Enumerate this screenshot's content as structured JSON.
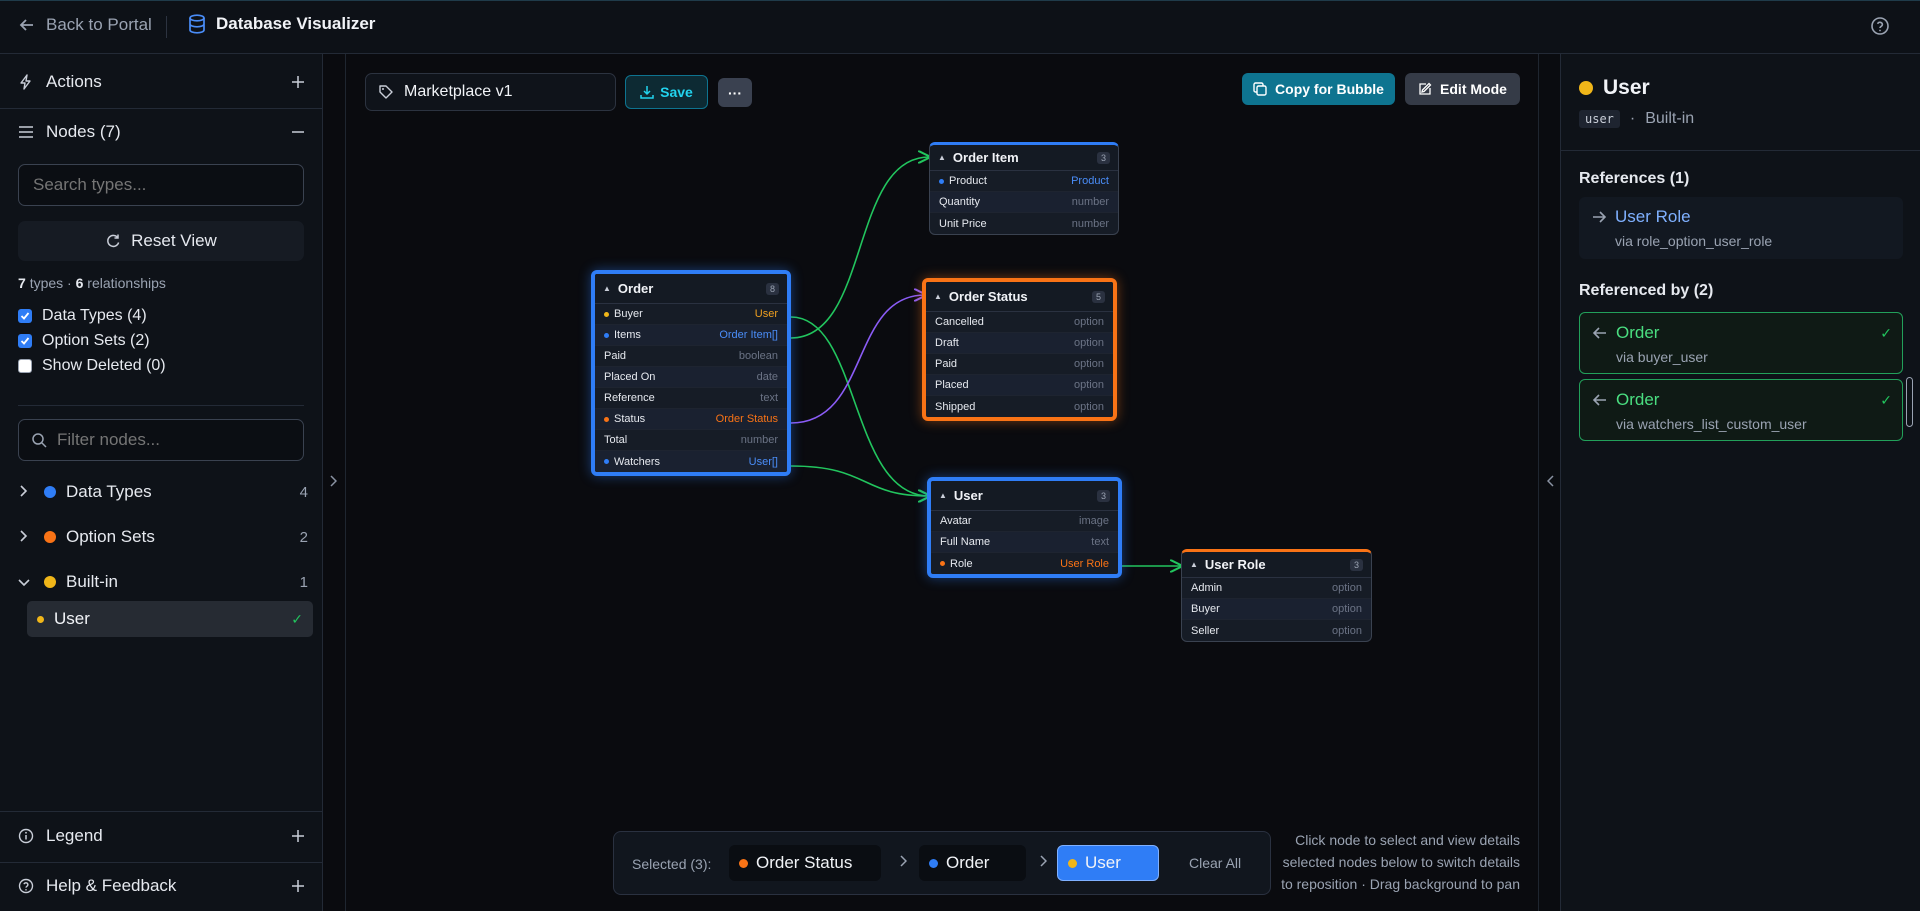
{
  "topbar": {
    "back_label": "Back to Portal",
    "app_title": "Database Visualizer"
  },
  "sidebar": {
    "actions_label": "Actions",
    "nodes_label": "Nodes (7)",
    "search_placeholder": "Search types...",
    "reset_label": "Reset View",
    "stats": {
      "types_count": "7",
      "types_word": "types",
      "sep": "·",
      "rel_count": "6",
      "rel_word": "relationships"
    },
    "filters": [
      {
        "label": "Data Types (4)",
        "checked": true
      },
      {
        "label": "Option Sets (2)",
        "checked": true
      },
      {
        "label": "Show Deleted (0)",
        "checked": false
      }
    ],
    "filter_placeholder": "Filter nodes...",
    "tree": [
      {
        "label": "Data Types",
        "count": "4",
        "color": "#2f7df6",
        "expanded": false
      },
      {
        "label": "Option Sets",
        "count": "2",
        "color": "#f97316",
        "expanded": false
      },
      {
        "label": "Built-in",
        "count": "1",
        "color": "#f0b619",
        "expanded": true
      }
    ],
    "tree_leaf": {
      "label": "User",
      "check": "✓"
    },
    "legend_label": "Legend",
    "help_label": "Help & Feedback"
  },
  "toolbar": {
    "schema_name": "Marketplace v1",
    "save_label": "Save",
    "more_label": "···",
    "copy_label": "Copy for Bubble",
    "edit_label": "Edit Mode"
  },
  "nodes": {
    "order": {
      "title": "Order",
      "count": "8",
      "fields": [
        {
          "name": "Buyer",
          "type": "User"
        },
        {
          "name": "Items",
          "type": "Order Item[]"
        },
        {
          "name": "Paid",
          "type": "boolean"
        },
        {
          "name": "Placed On",
          "type": "date"
        },
        {
          "name": "Reference",
          "type": "text"
        },
        {
          "name": "Status",
          "type": "Order Status"
        },
        {
          "name": "Total",
          "type": "number"
        },
        {
          "name": "Watchers",
          "type": "User[]"
        }
      ]
    },
    "order_item": {
      "title": "Order Item",
      "count": "3",
      "fields": [
        {
          "name": "Product",
          "type": "Product"
        },
        {
          "name": "Quantity",
          "type": "number"
        },
        {
          "name": "Unit Price",
          "type": "number"
        }
      ]
    },
    "order_status": {
      "title": "Order Status",
      "count": "5",
      "fields": [
        {
          "name": "Cancelled",
          "type": "option"
        },
        {
          "name": "Draft",
          "type": "option"
        },
        {
          "name": "Paid",
          "type": "option"
        },
        {
          "name": "Placed",
          "type": "option"
        },
        {
          "name": "Shipped",
          "type": "option"
        }
      ]
    },
    "user": {
      "title": "User",
      "count": "3",
      "fields": [
        {
          "name": "Avatar",
          "type": "image"
        },
        {
          "name": "Full Name",
          "type": "text"
        },
        {
          "name": "Role",
          "type": "User Role"
        }
      ]
    },
    "user_role": {
      "title": "User Role",
      "count": "3",
      "fields": [
        {
          "name": "Admin",
          "type": "option"
        },
        {
          "name": "Buyer",
          "type": "option"
        },
        {
          "name": "Seller",
          "type": "option"
        }
      ]
    }
  },
  "selection": {
    "label": "Selected (3):",
    "chips": [
      {
        "label": "Order Status",
        "color": "#f97316"
      },
      {
        "label": "Order",
        "color": "#2f7df6"
      },
      {
        "label": "User",
        "color": "#f0b619"
      }
    ],
    "clear_label": "Clear All",
    "hint_lines": [
      "Click node to select and view details",
      "selected nodes below to switch details",
      "to reposition · Drag background to pan"
    ]
  },
  "details": {
    "title": "User",
    "code": "user",
    "sep": "·",
    "kind": "Built-in",
    "references_heading": "References (1)",
    "references": [
      {
        "name": "User Role",
        "via": "via role_option_user_role"
      }
    ],
    "referenced_by_heading": "Referenced by (2)",
    "referenced_by": [
      {
        "name": "Order",
        "via": "via buyer_user",
        "check": "✓"
      },
      {
        "name": "Order",
        "via": "via watchers_list_custom_user",
        "check": "✓"
      }
    ]
  },
  "colors": {
    "data_type": "#2f7df6",
    "option_set": "#f97316",
    "built_in": "#f0b619",
    "edge_green": "#22c55e",
    "edge_purple": "#8b5cf6",
    "accent_teal": "#0e7490"
  }
}
